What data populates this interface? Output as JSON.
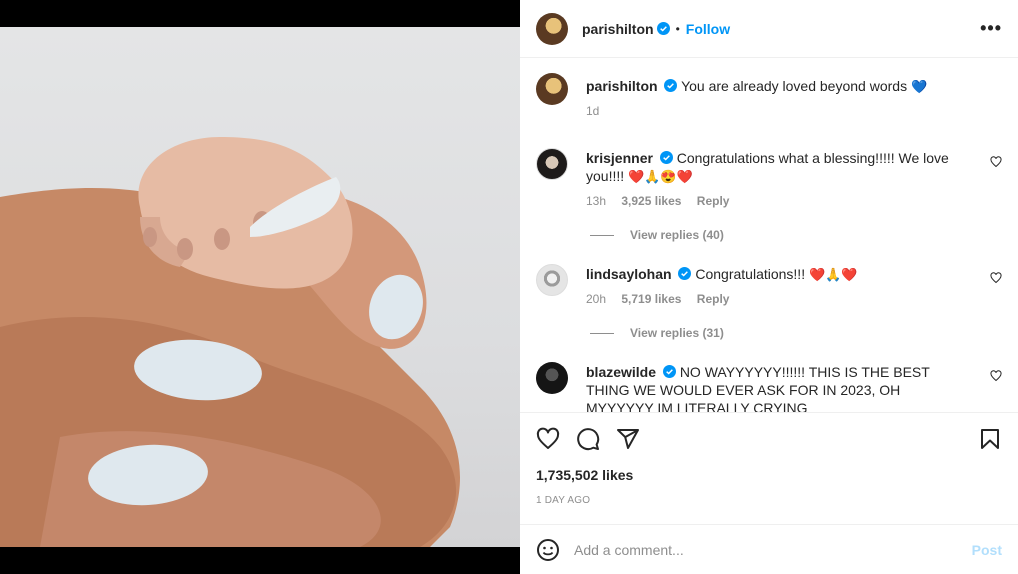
{
  "post": {
    "username": "parishilton",
    "follow_label": "Follow",
    "more_label": "•••",
    "caption": "You are already loved beyond words",
    "caption_emoji": "💙",
    "caption_time": "1d",
    "likes": "1,735,502 likes",
    "posted_ago": "1 DAY AGO"
  },
  "comments": [
    {
      "username": "krisjenner",
      "text": "Congratulations what a blessing!!!!! We love you!!!!",
      "emoji": "❤️🙏😍❤️",
      "time": "13h",
      "likes": "3,925 likes",
      "reply_label": "Reply",
      "view_replies": "View replies (40)"
    },
    {
      "username": "lindsaylohan",
      "text": "Congratulations!!!",
      "emoji": "❤️🙏❤️",
      "time": "20h",
      "likes": "5,719 likes",
      "reply_label": "Reply",
      "view_replies": "View replies (31)"
    },
    {
      "username": "blazewilde",
      "text": "NO WAYYYYYY!!!!!! THIS IS THE BEST THING WE WOULD EVER ASK FOR IN 2023, OH MYYYYYY IM LITERALLY CRYING",
      "emoji": "",
      "time": "",
      "likes": "",
      "reply_label": "",
      "view_replies": ""
    }
  ],
  "add_comment": {
    "placeholder": "Add a comment...",
    "post_label": "Post"
  },
  "icons": {
    "like": "heart-icon",
    "comment": "comment-icon",
    "share": "share-icon",
    "save": "bookmark-icon",
    "emoji": "emoji-icon",
    "verified": "verified-badge-icon"
  },
  "colors": {
    "accent": "#0095f6",
    "post_disabled": "#b2dffc",
    "secondary_text": "#8e8e8e",
    "nail": "#dfe8ee"
  }
}
